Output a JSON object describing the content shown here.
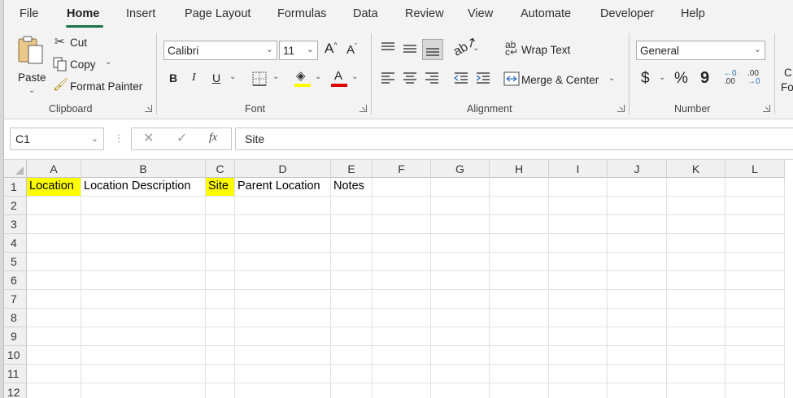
{
  "menu": {
    "tabs": [
      "File",
      "Home",
      "Insert",
      "Page Layout",
      "Formulas",
      "Data",
      "Review",
      "View",
      "Automate",
      "Developer",
      "Help"
    ],
    "active": "Home"
  },
  "ribbon": {
    "clipboard": {
      "paste": "Paste",
      "cut": "Cut",
      "copy": "Copy",
      "format_painter": "Format Painter",
      "label": "Clipboard"
    },
    "font": {
      "family": "Calibri",
      "size": "11",
      "bold": "B",
      "italic": "I",
      "underline": "U",
      "label": "Font",
      "grow": "A",
      "shrink": "A",
      "font_color_letter": "A",
      "highlight_color": "#ffff00",
      "font_color": "#e00000"
    },
    "alignment": {
      "wrap_text": "Wrap Text",
      "merge_center": "Merge & Center",
      "label": "Alignment"
    },
    "number": {
      "format": "General",
      "currency": "$",
      "percent": "%",
      "comma": "9",
      "label": "Number"
    },
    "cut_off": {
      "line1": "C",
      "line2": "Fo"
    }
  },
  "formula_bar": {
    "name_box": "C1",
    "fx": "fx",
    "content": "Site"
  },
  "sheet": {
    "columns": [
      "A",
      "B",
      "C",
      "D",
      "E",
      "F",
      "G",
      "H",
      "I",
      "J",
      "K",
      "L"
    ],
    "rows": [
      "1",
      "2",
      "3",
      "4",
      "5",
      "6",
      "7",
      "8",
      "9",
      "10",
      "11",
      "12"
    ],
    "row1": [
      "Location",
      "Location Description",
      "Site",
      "Parent Location",
      "Notes"
    ],
    "highlight_color": "#ffff00"
  }
}
